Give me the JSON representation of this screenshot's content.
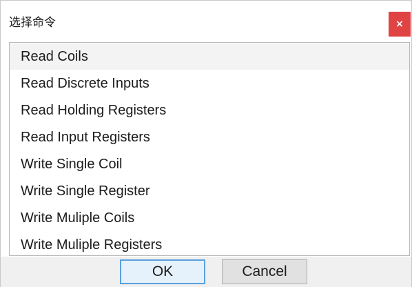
{
  "window": {
    "title": "选择命令",
    "close_label": "×"
  },
  "commands": {
    "items": [
      {
        "label": "Read Coils",
        "selected": true
      },
      {
        "label": "Read Discrete Inputs",
        "selected": false
      },
      {
        "label": "Read Holding Registers",
        "selected": false
      },
      {
        "label": "Read Input Registers",
        "selected": false
      },
      {
        "label": "Write Single Coil",
        "selected": false
      },
      {
        "label": "Write Single Register",
        "selected": false
      },
      {
        "label": "Write Muliple Coils",
        "selected": false
      },
      {
        "label": "Write Muliple Registers",
        "selected": false
      }
    ]
  },
  "buttons": {
    "ok_label": "OK",
    "cancel_label": "Cancel"
  },
  "colors": {
    "close_button": "#e04343",
    "ok_border": "#5aa0dd"
  }
}
